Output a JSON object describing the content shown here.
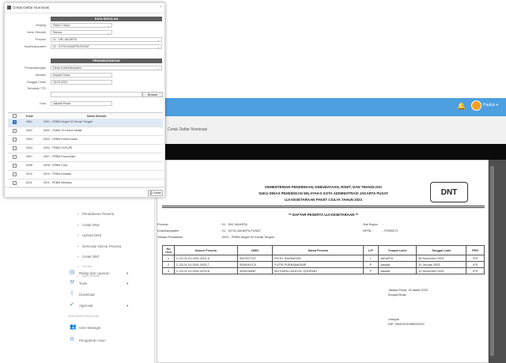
{
  "topbar": {
    "user_name": "Paulus ▾",
    "bell_icon": "bell-icon",
    "color": "#4d9fe0"
  },
  "page_title": "Cetak Daftar Nominasi",
  "sidebar": {
    "items": [
      {
        "label": "Pendaftaran Peserta",
        "sub": true
      },
      {
        "label": "Cetak DNS",
        "sub": true
      },
      {
        "label": "Upload DNS",
        "sub": true
      },
      {
        "label": "Generate Nomor Peserta",
        "sub": true
      },
      {
        "label": "Cetak DNT",
        "sub": true
      },
      {
        "label": "UJ Link",
        "sub": true
      },
      {
        "label": "Kartu Peserta",
        "sub": true
      },
      {
        "label": "Rekap dan Laporan",
        "sub": false
      },
      {
        "label": "Tools",
        "sub": false
      },
      {
        "label": "Download",
        "sub": false
      },
      {
        "label": "Approval",
        "sub": false
      },
      {
        "label": "MANAJEMEN PENGGUNA",
        "sub": false,
        "section": true
      },
      {
        "label": "User Manager",
        "sub": false
      },
      {
        "label": "Pengaturan Akun",
        "sub": false
      }
    ]
  },
  "report": {
    "header": [
      "KEMENTERIAN PENDIDIKAN, KEBUDAYAAN, RISET, DAN TEKNOLOGI",
      "SUKU DINAS PENDIDIKAN WILAYAH II KOTA ADMINISTRASI JAKARTA PUSAT",
      "UJI KESETARAAN PAKET C/ULYA TAHUN 2023"
    ],
    "badge": "DNT",
    "subtitle": "** DAFTAR  PESERTA UJI KESETARAAN **",
    "info_left": [
      {
        "label": "Provinsi",
        "value": ": 01 - DKI JAKARTA"
      },
      {
        "label": "Kota/Kabupaten",
        "value": ": 01 - KOTA JAKARTA PUSAT"
      },
      {
        "label": "Satuan Pendidikan",
        "value": ": 0001 - PKBM Negeri 02 Kenari Tengah"
      }
    ],
    "info_right": [
      {
        "label": "Sub Rayon",
        "value": ":"
      },
      {
        "label": "NPSN",
        "value": ": P2990071"
      }
    ],
    "columns": [
      "No Urut",
      "Nomor Peserta",
      "NISN",
      "Nama Peserta",
      "L/P",
      "Tempat Lahir",
      "Tanggal Lahir",
      "PRG"
    ],
    "rows": [
      [
        "1",
        "C-23-01-01-0001-0001-6",
        "0047527157",
        "RICKY RAHMATAN",
        "L",
        "JAKARTA",
        "06 November 2003",
        "IPS"
      ],
      [
        "2",
        "C-23-01-01-0001-0002-7",
        "0039041074",
        "PUTRI PURNAMASARI",
        "P",
        "Jakarta",
        "10 Januari 2003",
        "IPS"
      ],
      [
        "3",
        "C-23-01-01-0001-0003-6",
        "3040038687",
        "MUTIARA LAILATUL QODRIAH",
        "P",
        "Jakarta",
        "12 November 2004",
        "IPS"
      ]
    ],
    "place_date": "Jakarta Pusat, 15 Maret 2023",
    "signer_title": "Kepala Dinas",
    "signer_name": "Untoyoh",
    "signer_nip": "NIP. 196409231985032007"
  },
  "modal": {
    "title": "Cetak Daftar Nominasi",
    "section_data": "DATA SEKOLAH",
    "section_sign": "PENANDATANGAN",
    "fields": {
      "jenjang": {
        "label": "Jenjang",
        "value": "Paket C/Ulya"
      },
      "jenis_sekolah": {
        "label": "Jenis Sekolah",
        "value": "Semua"
      },
      "provinsi": {
        "label": "Provinsi",
        "value": "01 - DKI JAKARTA"
      },
      "kota": {
        "label": "Kota/Kabupaten",
        "value": "01 - KOTA JAKARTA PUSAT"
      },
      "penandatangan": {
        "label": "Penandatangan",
        "value": "Dinas Kota/Kabupaten"
      },
      "jabatan": {
        "label": "Jabatan",
        "value": "Kepala Dinas"
      },
      "tanggal": {
        "label": "Tanggal Cetak",
        "value": "15-03-2023"
      },
      "template": {
        "label": "Template TTE",
        "value": ""
      },
      "kota_ttd": {
        "label": "Kota",
        "value": "Jakarta Pusat"
      }
    },
    "browse_label": "Browse",
    "table_headers": [
      "Kode",
      "Nama Sekolah"
    ],
    "schools": [
      {
        "kode": "0001",
        "nama": "0001 - PKBM Negeri 02 Kenari Tengah",
        "checked": true
      },
      {
        "kode": "0002",
        "nama": "0002 - PKBM 15 Kebon Melati",
        "checked": false
      },
      {
        "kode": "0003",
        "nama": "0003 - PKBM Kartini Insani",
        "checked": false
      },
      {
        "kode": "0004",
        "nama": "0004 - PKBM VOKORI",
        "checked": false
      },
      {
        "kode": "0007",
        "nama": "0007 - PKBM Panca Asih",
        "checked": false
      },
      {
        "kode": "0008",
        "nama": "0008 - PKBM Citra",
        "checked": false
      },
      {
        "kode": "0010",
        "nama": "0010 - PKBM Bulaatis",
        "checked": false
      },
      {
        "kode": "0011",
        "nama": "0011 - PKBM Windayu",
        "checked": false
      }
    ],
    "print_label": "Cetak"
  }
}
